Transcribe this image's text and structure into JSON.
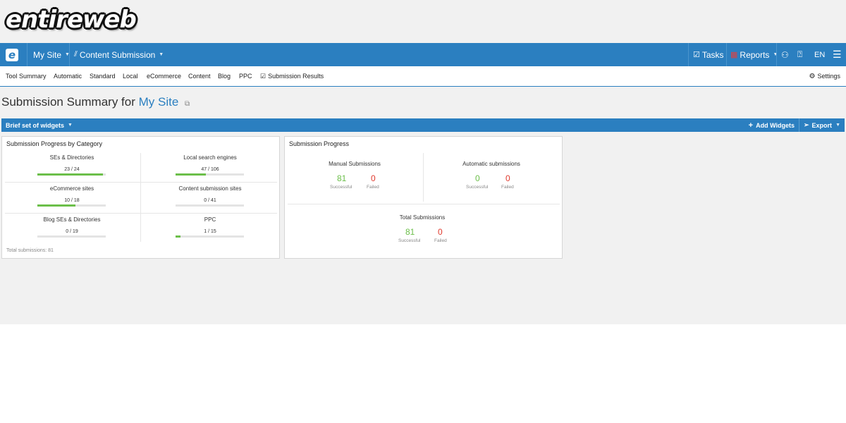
{
  "logo": {
    "text": "entireweb"
  },
  "topbar": {
    "brand_letter": "e",
    "site_label": "My Site",
    "module_label": "Content Submission",
    "tasks_label": "Tasks",
    "reports_label": "Reports",
    "lang_label": "EN"
  },
  "subnav": {
    "tabs": [
      "Tool Summary",
      "Automatic",
      "Standard",
      "Local",
      "eCommerce",
      "Content",
      "Blog",
      "PPC",
      "Submission Results"
    ],
    "settings_label": "Settings"
  },
  "heading": {
    "prefix": "Submission Summary for",
    "site": "My Site"
  },
  "widgetbar": {
    "set_label": "Brief set of widgets",
    "add_label": "Add Widgets",
    "export_label": "Export"
  },
  "category_card": {
    "title": "Submission Progress by Category",
    "categories": [
      {
        "name": "SEs & Directories",
        "count": "23 / 24",
        "progress": 0.96
      },
      {
        "name": "Local search engines",
        "count": "47 / 106",
        "progress": 0.44
      },
      {
        "name": "eCommerce sites",
        "count": "10 / 18",
        "progress": 0.56
      },
      {
        "name": "Content submission sites",
        "count": "0 / 41",
        "progress": 0
      },
      {
        "name": "Blog SEs & Directories",
        "count": "0 / 19",
        "progress": 0
      },
      {
        "name": "PPC",
        "count": "1 / 15",
        "progress": 0.07
      }
    ],
    "total_note": "Total submissions: 81"
  },
  "progress_card": {
    "title": "Submission Progress",
    "manual": {
      "title": "Manual Submissions",
      "successful": "81",
      "failed": "0"
    },
    "automatic": {
      "title": "Automatic submissions",
      "successful": "0",
      "failed": "0"
    },
    "total": {
      "title": "Total Submissions",
      "successful": "81",
      "failed": "0"
    },
    "successful_label": "Successful",
    "failed_label": "Failed"
  },
  "colors": {
    "primary": "#2b7fc0",
    "success": "#6cbf4a",
    "danger": "#e03a2e",
    "background": "#f1f1f1"
  }
}
